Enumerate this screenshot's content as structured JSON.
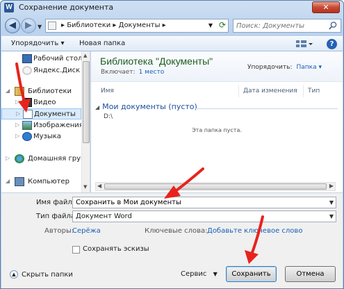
{
  "window": {
    "app_icon_letter": "W",
    "title": "Сохранение документа",
    "close_symbol": "✕"
  },
  "navigation": {
    "breadcrumb": "▸ Библиотеки ▸ Документы ▸",
    "search_placeholder": "Поиск: Документы"
  },
  "toolbar": {
    "organize_label": "Упорядочить ▾",
    "new_folder_label": "Новая папка",
    "help_symbol": "?"
  },
  "sidebar": {
    "items": [
      {
        "label": "Рабочий стол"
      },
      {
        "label": "Яндекс.Диск"
      },
      {
        "label": "Библиотеки"
      },
      {
        "label": "Видео"
      },
      {
        "label": "Документы"
      },
      {
        "label": "Изображения"
      },
      {
        "label": "Музыка"
      },
      {
        "label": "Домашняя группа"
      },
      {
        "label": "Компьютер"
      }
    ]
  },
  "library": {
    "title": "Библиотека \"Документы\"",
    "includes_label": "Включает:",
    "includes_link": "1 место",
    "arrange_label": "Упорядочить:",
    "arrange_value": "Папка ▾",
    "columns": [
      "Имя",
      "Дата изменения",
      "Тип"
    ],
    "group_header": "Мои документы (пусто)",
    "group_path": "D:\\",
    "empty_message": "Эта папка пуста."
  },
  "form": {
    "filename_label": "Имя файла:",
    "filename_value": "Сохранить в Мои документы",
    "filetype_label": "Тип файла:",
    "filetype_value": "Документ Word",
    "authors_label": "Авторы:",
    "authors_value": "Серёжа",
    "keywords_label": "Ключевые слова:",
    "keywords_value": "Добавьте ключевое слово",
    "thumbnails_label": "Сохранять эскизы"
  },
  "footer": {
    "hide_folders_label": "Скрыть папки",
    "service_label": "Сервис",
    "save_label": "Сохранить",
    "cancel_label": "Отмена"
  },
  "colors": {
    "annotation_arrow": "#e8231d",
    "link": "#1a5fb4",
    "library_title": "#1f5b1f"
  }
}
